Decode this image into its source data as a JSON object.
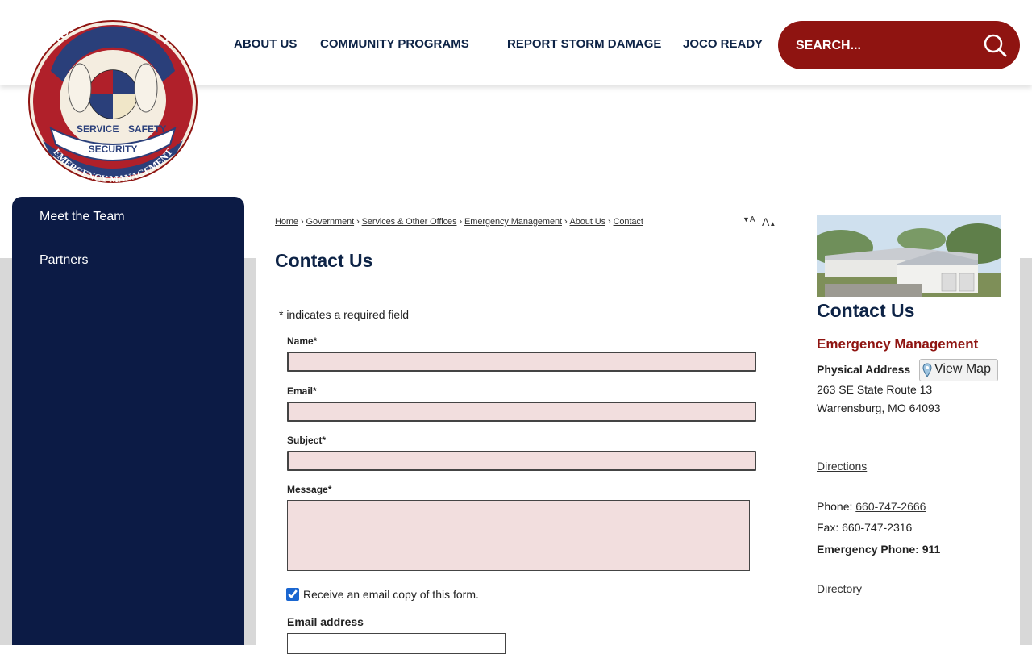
{
  "logo": {
    "top_text": "JOHNSON COUNTY",
    "bottom_text": "EMERGENCY MANAGEMENT",
    "ribbon_left": "SERVICE",
    "ribbon_right": "SAFETY",
    "ribbon_bottom": "SECURITY"
  },
  "nav": {
    "items": [
      "ABOUT US",
      "COMMUNITY PROGRAMS",
      "REPORT STORM DAMAGE",
      "JOCO READY"
    ]
  },
  "search": {
    "placeholder": "SEARCH..."
  },
  "sidebar": {
    "items": [
      "Meet the Team",
      "Partners"
    ]
  },
  "breadcrumb": [
    "Home",
    "Government",
    "Services & Other Offices",
    "Emergency Management",
    "About Us",
    "Contact"
  ],
  "font_tools": {
    "decrease": "A",
    "increase": "A"
  },
  "page_title": "Contact Us",
  "form": {
    "required_note": "* indicates a required field",
    "name_label": "Name*",
    "email_label": "Email*",
    "subject_label": "Subject*",
    "message_label": "Message*",
    "copy_label": "Receive an email copy of this form.",
    "copy_checked": true,
    "email_address_label": "Email address"
  },
  "contact": {
    "title": "Contact Us",
    "department": "Emergency Management",
    "physical_address_label": "Physical Address",
    "view_map": "View Map",
    "address_line1": "263 SE State Route 13",
    "address_line2": "Warrensburg, MO 64093",
    "directions": "Directions",
    "phone_label": "Phone:",
    "phone": "660-747-2666",
    "fax": "Fax: 660-747-2316",
    "emergency_label": "Emergency Phone:",
    "emergency_phone": "911",
    "directory": "Directory"
  },
  "colors": {
    "navy": "#0d2346",
    "sidebar": "#0c1b45",
    "brand_red": "#8f1411",
    "field_bg": "#f2dede"
  }
}
